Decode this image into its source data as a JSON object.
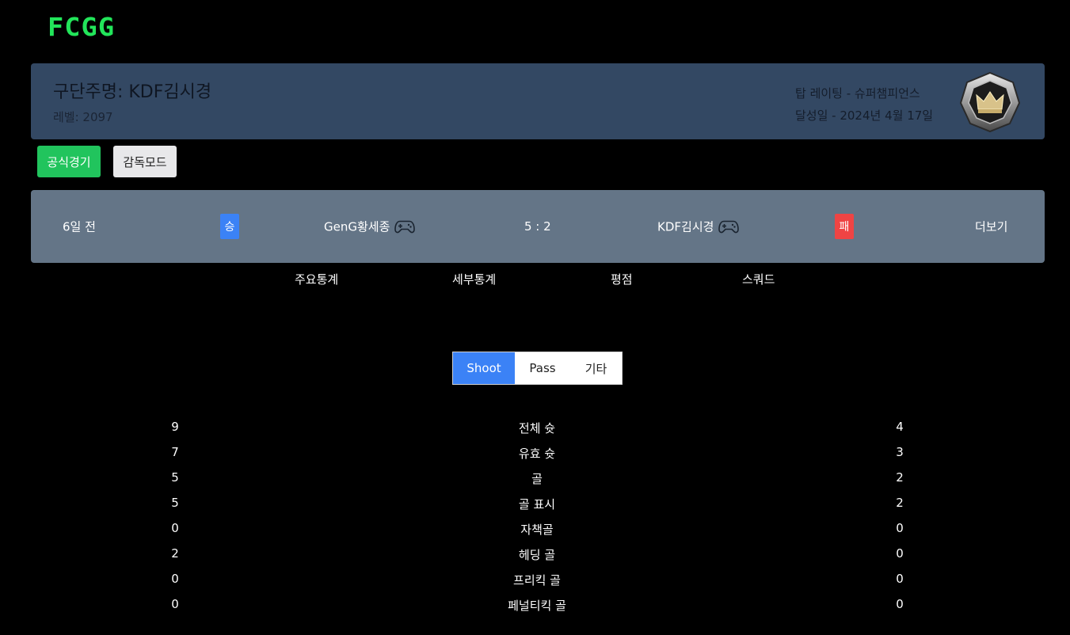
{
  "header": {
    "logo": "FCGG"
  },
  "profile": {
    "name": "구단주명: KDF김시경",
    "level": "레벨: 2097",
    "top_rating": "탑 레이팅 - 슈퍼챔피언스",
    "achieved": "달성일 - 2024년 4월 17일",
    "badge_icon": "super-champions-crown-badge-icon"
  },
  "modes": {
    "official": "공식경기",
    "manager": "감독모드",
    "active": "official"
  },
  "match": {
    "time": "6일 전",
    "home_result": "승",
    "home_name": "GenG황세종",
    "score": "5 : 2",
    "away_name": "KDF김시경",
    "away_result": "패",
    "more": "더보기",
    "win_color": "#3b82f6",
    "lose_color": "#ef4444",
    "controller_icon": "gamepad-icon"
  },
  "tabs": [
    "주요통계",
    "세부통계",
    "평점",
    "스쿼드"
  ],
  "segment": {
    "options": [
      "Shoot",
      "Pass",
      "기타"
    ],
    "selected": "Shoot"
  },
  "stats": [
    {
      "home": "9",
      "label": "전체 슛",
      "away": "4"
    },
    {
      "home": "7",
      "label": "유효 슛",
      "away": "3"
    },
    {
      "home": "5",
      "label": "골",
      "away": "2"
    },
    {
      "home": "5",
      "label": "골 표시",
      "away": "2"
    },
    {
      "home": "0",
      "label": "자책골",
      "away": "0"
    },
    {
      "home": "2",
      "label": "헤딩 골",
      "away": "0"
    },
    {
      "home": "0",
      "label": "프리킥 골",
      "away": "0"
    },
    {
      "home": "0",
      "label": "페널티킥 골",
      "away": "0"
    }
  ],
  "colors": {
    "logo": "#22e55a",
    "profile_bg": "#334863",
    "match_bg": "#647587",
    "official_btn": "#21c45d",
    "segment_active": "#3b82f6"
  }
}
